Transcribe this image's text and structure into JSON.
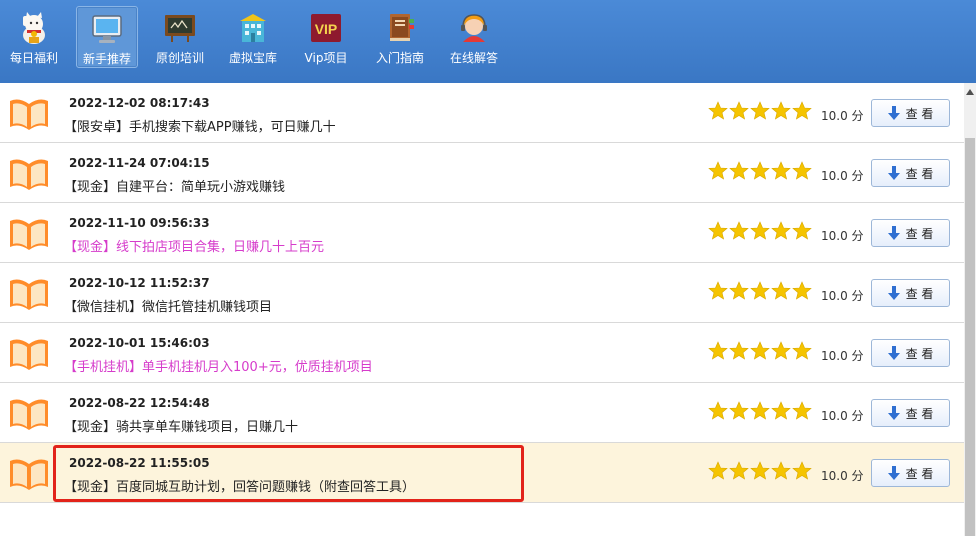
{
  "toolbar": {
    "items": [
      {
        "label": "每日福利",
        "icon": "lucky-cat-icon"
      },
      {
        "label": "新手推荐",
        "icon": "monitor-icon",
        "active": true
      },
      {
        "label": "原创培训",
        "icon": "chalkboard-icon"
      },
      {
        "label": "虚拟宝库",
        "icon": "building-icon"
      },
      {
        "label": "Vip项目",
        "icon": "vip-icon",
        "badge": "VIP"
      },
      {
        "label": "入门指南",
        "icon": "book-icon"
      },
      {
        "label": "在线解答",
        "icon": "support-agent-icon"
      }
    ]
  },
  "list": {
    "rows": [
      {
        "date": "2022-12-02 08:17:43",
        "title": "【限安卓】手机搜索下载APP赚钱，可日赚几十",
        "title_color": "#222222",
        "rating": 5,
        "score": "10.0 分",
        "button": "查 看"
      },
      {
        "date": "2022-11-24 07:04:15",
        "title": "【现金】自建平台：简单玩小游戏赚钱",
        "title_color": "#222222",
        "rating": 5,
        "score": "10.0 分",
        "button": "查 看"
      },
      {
        "date": "2022-11-10 09:56:33",
        "title": "【现金】线下拍店项目合集，日赚几十上百元",
        "title_color": "#d63ccb",
        "rating": 5,
        "score": "10.0 分",
        "button": "查 看"
      },
      {
        "date": "2022-10-12 11:52:37",
        "title": "【微信挂机】微信托管挂机赚钱项目",
        "title_color": "#222222",
        "rating": 5,
        "score": "10.0 分",
        "button": "查 看"
      },
      {
        "date": "2022-10-01 15:46:03",
        "title": "【手机挂机】单手机挂机月入100+元，优质挂机项目",
        "title_color": "#d63ccb",
        "rating": 5,
        "score": "10.0 分",
        "button": "查 看"
      },
      {
        "date": "2022-08-22 12:54:48",
        "title": "【现金】骑共享单车赚钱项目，日赚几十",
        "title_color": "#222222",
        "rating": 5,
        "score": "10.0 分",
        "button": "查 看"
      },
      {
        "date": "2022-08-22 11:55:05",
        "title": "【现金】百度同城互助计划，回答问题赚钱（附查回答工具）",
        "title_color": "#222222",
        "rating": 5,
        "score": "10.0 分",
        "button": "查 看",
        "highlight": true
      }
    ]
  },
  "colors": {
    "toolbar_bg": "#3f7fcf",
    "star": "#f5c400",
    "highlight_row": "#fdf4dc",
    "callout_border": "#e2231a",
    "pink_title": "#d63ccb",
    "button_arrow": "#2f6fd1"
  }
}
